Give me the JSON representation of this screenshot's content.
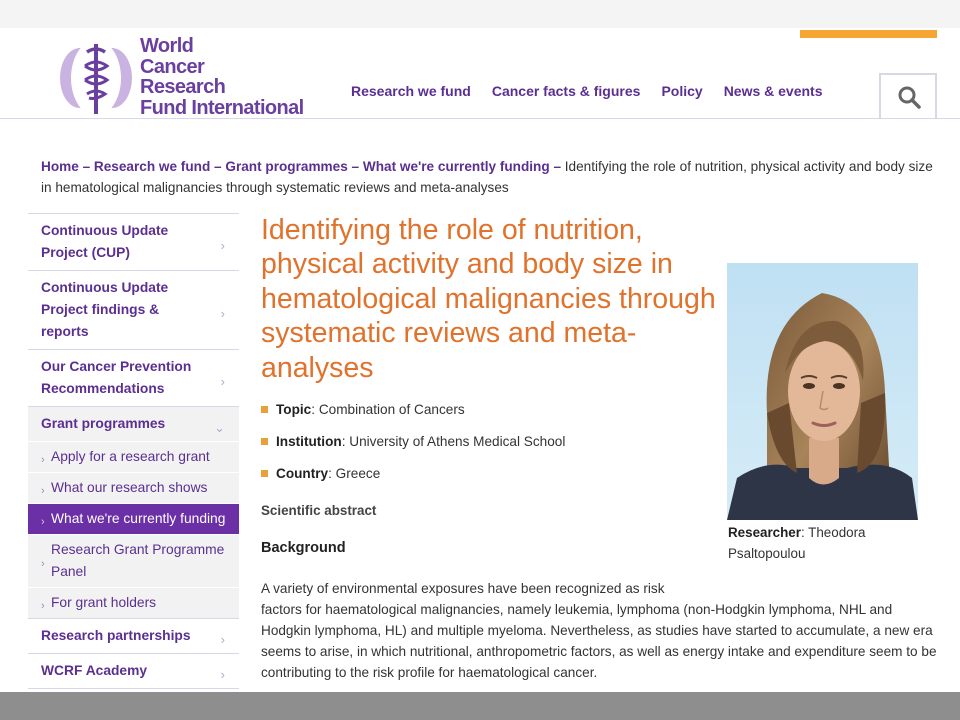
{
  "header": {
    "logo_lines": [
      "World",
      "Cancer",
      "Research",
      "Fund International"
    ],
    "nav": [
      "Research we fund",
      "Cancer facts & figures",
      "Policy",
      "News & events"
    ],
    "search_icon": "search-icon",
    "accent_color": "#f7a632",
    "brand_color": "#5b2f91"
  },
  "breadcrumb": {
    "links": [
      "Home",
      "Research we fund",
      "Grant programmes",
      "What we're currently funding"
    ],
    "separator": "–",
    "current": "Identifying the role of nutrition, physical activity and body size in hematological malignancies through systematic reviews and meta-analyses"
  },
  "sidebar": {
    "items": [
      {
        "label": "Continuous Update Project (CUP)",
        "icon": "chevron-right-icon"
      },
      {
        "label": "Continuous Update Project findings & reports",
        "icon": "chevron-right-icon"
      },
      {
        "label": "Our Cancer Prevention Recommendations",
        "icon": "chevron-right-icon"
      },
      {
        "label": "Grant programmes",
        "icon": "chevron-down-icon",
        "expanded": true
      }
    ],
    "subitems": [
      {
        "label": "Apply for a research grant"
      },
      {
        "label": "What our research shows"
      },
      {
        "label": "What we're currently funding",
        "active": true
      },
      {
        "label": "Research Grant Programme Panel"
      },
      {
        "label": "For grant holders"
      }
    ],
    "bottom_items": [
      {
        "label": "Research partnerships",
        "icon": "chevron-right-icon"
      },
      {
        "label": "WCRF Academy",
        "icon": "chevron-right-icon"
      }
    ],
    "active_color": "#6b2fa6"
  },
  "content": {
    "title": "Identifying the role of nutrition, physical activity and body size in hematological malignancies through systematic reviews and meta-analyses",
    "title_color": "#e0722c",
    "meta": [
      {
        "label": "Topic",
        "value": "Combination of Cancers"
      },
      {
        "label": "Institution",
        "value": "University of Athens Medical School"
      },
      {
        "label": "Country",
        "value": "Greece"
      }
    ],
    "abstract_heading": "Scientific abstract",
    "background_heading": "Background",
    "body_line1": "A variety of environmental exposures have been recognized as risk",
    "body_rest": "factors for haematological malignancies, namely leukemia, lymphoma (non-Hodgkin lymphoma, NHL and Hodgkin lymphoma, HL) and multiple myeloma. Nevertheless, as studies have started to accumulate, a new era seems to arise, in which nutritional, anthropometric factors, as well as energy intake and expenditure seem to be contributing to the risk profile for haematological cancer."
  },
  "researcher": {
    "label": "Researcher",
    "name": "Theodora Psaltopoulou"
  }
}
